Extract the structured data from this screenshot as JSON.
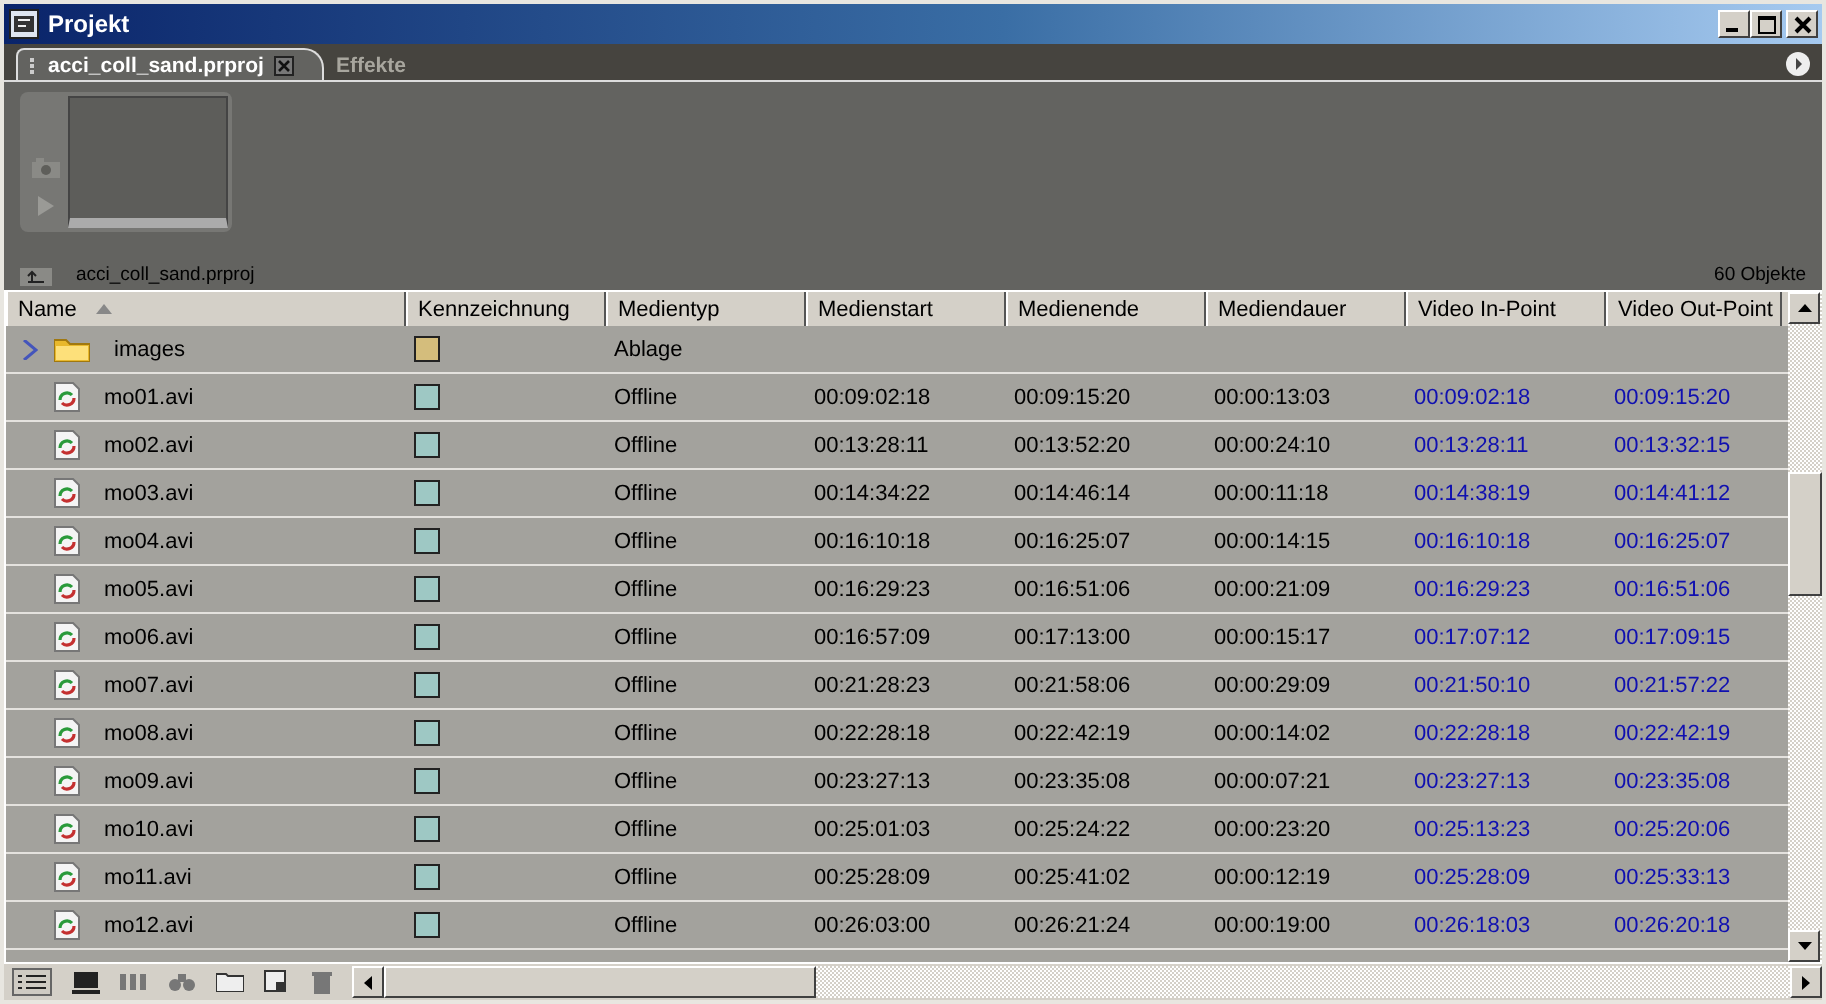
{
  "window": {
    "title": "Projekt"
  },
  "tabs": [
    {
      "label": "acci_coll_sand.prproj",
      "selected": true
    },
    {
      "label": "Effekte",
      "selected": false
    }
  ],
  "preview": {
    "file": "acci_coll_sand.prproj",
    "count": "60 Objekte"
  },
  "table": {
    "columns": [
      {
        "label": "Name",
        "sorted": true
      },
      {
        "label": "Kennzeichnung",
        "sorted": false
      },
      {
        "label": "Medientyp",
        "sorted": false
      },
      {
        "label": "Medienstart",
        "sorted": false
      },
      {
        "label": "Medienende",
        "sorted": false
      },
      {
        "label": "Mediendauer",
        "sorted": false
      },
      {
        "label": "Video In-Point",
        "sorted": false
      },
      {
        "label": "Video Out-Point",
        "sorted": false
      }
    ],
    "rows": [
      {
        "kind": "folder",
        "name": "images",
        "color": "#d4bd7c",
        "expanded": false,
        "media_type": "Ablage"
      },
      {
        "kind": "file",
        "name": "mo01.avi",
        "color": "#9ec8c4",
        "media_type": "Offline",
        "start": "00:09:02:18",
        "end": "00:09:15:20",
        "duration": "00:00:13:03",
        "in_point": "00:09:02:18",
        "out_point": "00:09:15:20"
      },
      {
        "kind": "file",
        "name": "mo02.avi",
        "color": "#9ec8c4",
        "media_type": "Offline",
        "start": "00:13:28:11",
        "end": "00:13:52:20",
        "duration": "00:00:24:10",
        "in_point": "00:13:28:11",
        "out_point": "00:13:32:15"
      },
      {
        "kind": "file",
        "name": "mo03.avi",
        "color": "#9ec8c4",
        "media_type": "Offline",
        "start": "00:14:34:22",
        "end": "00:14:46:14",
        "duration": "00:00:11:18",
        "in_point": "00:14:38:19",
        "out_point": "00:14:41:12"
      },
      {
        "kind": "file",
        "name": "mo04.avi",
        "color": "#9ec8c4",
        "media_type": "Offline",
        "start": "00:16:10:18",
        "end": "00:16:25:07",
        "duration": "00:00:14:15",
        "in_point": "00:16:10:18",
        "out_point": "00:16:25:07"
      },
      {
        "kind": "file",
        "name": "mo05.avi",
        "color": "#9ec8c4",
        "media_type": "Offline",
        "start": "00:16:29:23",
        "end": "00:16:51:06",
        "duration": "00:00:21:09",
        "in_point": "00:16:29:23",
        "out_point": "00:16:51:06"
      },
      {
        "kind": "file",
        "name": "mo06.avi",
        "color": "#9ec8c4",
        "media_type": "Offline",
        "start": "00:16:57:09",
        "end": "00:17:13:00",
        "duration": "00:00:15:17",
        "in_point": "00:17:07:12",
        "out_point": "00:17:09:15"
      },
      {
        "kind": "file",
        "name": "mo07.avi",
        "color": "#9ec8c4",
        "media_type": "Offline",
        "start": "00:21:28:23",
        "end": "00:21:58:06",
        "duration": "00:00:29:09",
        "in_point": "00:21:50:10",
        "out_point": "00:21:57:22"
      },
      {
        "kind": "file",
        "name": "mo08.avi",
        "color": "#9ec8c4",
        "media_type": "Offline",
        "start": "00:22:28:18",
        "end": "00:22:42:19",
        "duration": "00:00:14:02",
        "in_point": "00:22:28:18",
        "out_point": "00:22:42:19"
      },
      {
        "kind": "file",
        "name": "mo09.avi",
        "color": "#9ec8c4",
        "media_type": "Offline",
        "start": "00:23:27:13",
        "end": "00:23:35:08",
        "duration": "00:00:07:21",
        "in_point": "00:23:27:13",
        "out_point": "00:23:35:08"
      },
      {
        "kind": "file",
        "name": "mo10.avi",
        "color": "#9ec8c4",
        "media_type": "Offline",
        "start": "00:25:01:03",
        "end": "00:25:24:22",
        "duration": "00:00:23:20",
        "in_point": "00:25:13:23",
        "out_point": "00:25:20:06"
      },
      {
        "kind": "file",
        "name": "mo11.avi",
        "color": "#9ec8c4",
        "media_type": "Offline",
        "start": "00:25:28:09",
        "end": "00:25:41:02",
        "duration": "00:00:12:19",
        "in_point": "00:25:28:09",
        "out_point": "00:25:33:13"
      },
      {
        "kind": "file",
        "name": "mo12.avi",
        "color": "#9ec8c4",
        "media_type": "Offline",
        "start": "00:26:03:00",
        "end": "00:26:21:24",
        "duration": "00:00:19:00",
        "in_point": "00:26:18:03",
        "out_point": "00:26:20:18"
      }
    ]
  }
}
